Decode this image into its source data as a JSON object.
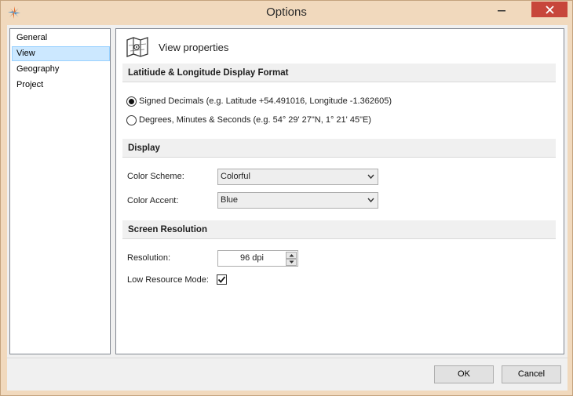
{
  "window": {
    "title": "Options",
    "icons": {
      "app": "app-logo-icon",
      "minimize": "minimize-icon",
      "close": "close-icon"
    },
    "colors": {
      "frame": "#f1d9bd",
      "close_button": "#c7463b",
      "selection": "#cce8ff"
    }
  },
  "nav": {
    "items": [
      {
        "label": "General",
        "selected": false
      },
      {
        "label": "View",
        "selected": true
      },
      {
        "label": "Geography",
        "selected": false
      },
      {
        "label": "Project",
        "selected": false
      }
    ]
  },
  "panel": {
    "icon": "map-icon",
    "title": "View properties",
    "sections": {
      "latlon": {
        "header": "Latitiude & Longitude Display Format",
        "options": [
          {
            "label": "Signed Decimals (e.g. Latitude +54.491016, Longitude -1.362605)",
            "checked": true
          },
          {
            "label": "Degrees, Minutes & Seconds (e.g. 54° 29' 27\"N, 1° 21' 45\"E)",
            "checked": false
          }
        ]
      },
      "display": {
        "header": "Display",
        "color_scheme_label": "Color Scheme:",
        "color_scheme_value": "Colorful",
        "color_accent_label": "Color Accent:",
        "color_accent_value": "Blue"
      },
      "resolution": {
        "header": "Screen Resolution",
        "resolution_label": "Resolution:",
        "resolution_value": "96 dpi",
        "low_resource_label": "Low Resource Mode:",
        "low_resource_checked": true
      }
    }
  },
  "footer": {
    "ok_label": "OK",
    "cancel_label": "Cancel"
  }
}
